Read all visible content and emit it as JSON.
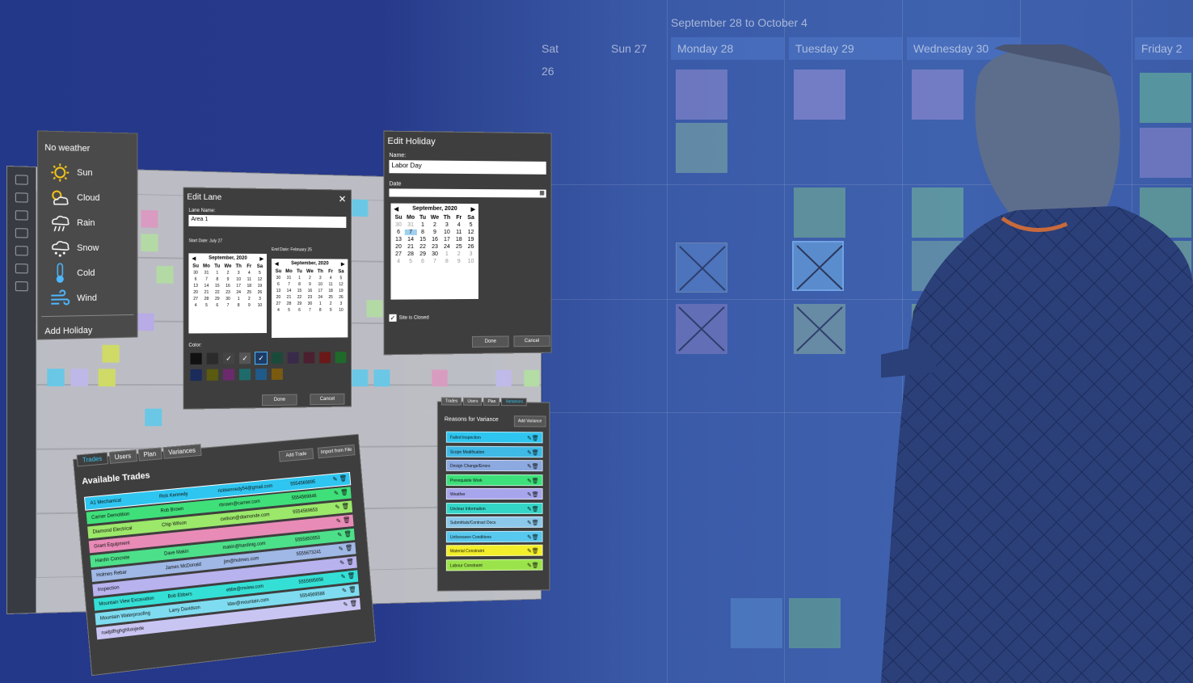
{
  "background_board": {
    "title": "September 28 to October 4",
    "days": [
      "Sat 26",
      "Sun 27",
      "Monday 28",
      "Tuesday 29",
      "Wednesday 30",
      "Friday 2"
    ]
  },
  "weather_menu": {
    "title": "No weather",
    "items": [
      {
        "label": "Sun",
        "icon": "sun-icon"
      },
      {
        "label": "Cloud",
        "icon": "cloud-icon"
      },
      {
        "label": "Rain",
        "icon": "rain-icon"
      },
      {
        "label": "Snow",
        "icon": "snow-icon"
      },
      {
        "label": "Cold",
        "icon": "thermometer-icon"
      },
      {
        "label": "Wind",
        "icon": "wind-icon"
      }
    ],
    "footer": "Add Holiday"
  },
  "edit_lane": {
    "title": "Edit Lane",
    "lane_name_label": "Lane Name:",
    "lane_name_value": "Area 1",
    "start_label": "Start Date: July 27",
    "end_label": "End Date: February 25",
    "left_month": "September, 2020",
    "right_month": "September, 2020",
    "color_label": "Color:",
    "done": "Done",
    "cancel": "Cancel"
  },
  "edit_holiday": {
    "title": "Edit Holiday",
    "name_label": "Name:",
    "name_value": "Labor Day",
    "date_label": "Date",
    "month": "September, 2020",
    "weekdays": [
      "Su",
      "Mo",
      "Tu",
      "We",
      "Th",
      "Fr",
      "Sa"
    ],
    "days": [
      "30",
      "31",
      "1",
      "2",
      "3",
      "4",
      "5",
      "6",
      "7",
      "8",
      "9",
      "10",
      "11",
      "12",
      "13",
      "14",
      "15",
      "16",
      "17",
      "18",
      "19",
      "20",
      "21",
      "22",
      "23",
      "24",
      "25",
      "26",
      "27",
      "28",
      "29",
      "30",
      "1",
      "2",
      "3",
      "4",
      "5",
      "6",
      "7",
      "8",
      "9",
      "10"
    ],
    "site_closed": "Site is Closed",
    "done": "Done",
    "cancel": "Cancel"
  },
  "trades_panel": {
    "tabs": [
      "Trades",
      "Users",
      "Plan",
      "Variances"
    ],
    "title": "Available Trades",
    "add_trade": "Add Trade",
    "import": "Import from File",
    "rows": [
      {
        "name": "A1 Mechanical",
        "contact": "Rick Kennedy",
        "email": "rickkennedy54@gmail.com",
        "phone": "5554569895",
        "color": "#2ec6f0"
      },
      {
        "name": "Carner Demolition",
        "contact": "Rob Brown",
        "email": "rbrown@carner.com",
        "phone": "5554569846",
        "color": "#3fe07a"
      },
      {
        "name": "Diamond Electrical",
        "contact": "Chip Wilson",
        "email": "cwilson@diamonde.com",
        "phone": "5554569653",
        "color": "#9ce86a"
      },
      {
        "name": "Grant Equipment",
        "contact": "",
        "email": "",
        "phone": "",
        "color": "#e98bb7"
      },
      {
        "name": "Hardin Concrete",
        "contact": "Dave Makin",
        "email": "makin@hardinig.com",
        "phone": "5555850953",
        "color": "#4de08a"
      },
      {
        "name": "Holmes Rebar",
        "contact": "James McDonald",
        "email": "jim@holmes.com",
        "phone": "5555673241",
        "color": "#9fb8e6"
      },
      {
        "name": "Inspection",
        "contact": "",
        "email": "",
        "phone": "",
        "color": "#b8b2ee"
      },
      {
        "name": "Mountain View Excavation",
        "contact": "Bob Ebbers",
        "email": "ebbe@mview.com",
        "phone": "5555695656",
        "color": "#34e0d6"
      },
      {
        "name": "Mountain Waterproofing",
        "contact": "Larry Davidson",
        "email": "ldav@mountain.com",
        "phone": "5554569588",
        "color": "#7fdcf0"
      },
      {
        "name": "rueljdfhghghfuiojede",
        "contact": "",
        "email": "",
        "phone": "",
        "color": "#c9c5f3"
      }
    ]
  },
  "variance_panel": {
    "tabs": [
      "Trades",
      "Users",
      "Plan",
      "Variances"
    ],
    "title": "Reasons for Variance",
    "add": "Add Variance",
    "rows": [
      {
        "label": "Failed Inspection",
        "color": "#2ec6f0"
      },
      {
        "label": "Scope Modification",
        "color": "#3fb9e6"
      },
      {
        "label": "Design Change/Errors",
        "color": "#8ca9e0"
      },
      {
        "label": "Prerequisite Work",
        "color": "#3de07a"
      },
      {
        "label": "Weather",
        "color": "#a7a6ec"
      },
      {
        "label": "Unclear Information",
        "color": "#34d6c8"
      },
      {
        "label": "Submittals/Contract Docs",
        "color": "#8cc8ea"
      },
      {
        "label": "Unforeseen Conditions",
        "color": "#57c8ee"
      },
      {
        "label": "Material Constraint",
        "color": "#f2ee2a"
      },
      {
        "label": "Labour Constraint",
        "color": "#9be34a"
      }
    ]
  }
}
